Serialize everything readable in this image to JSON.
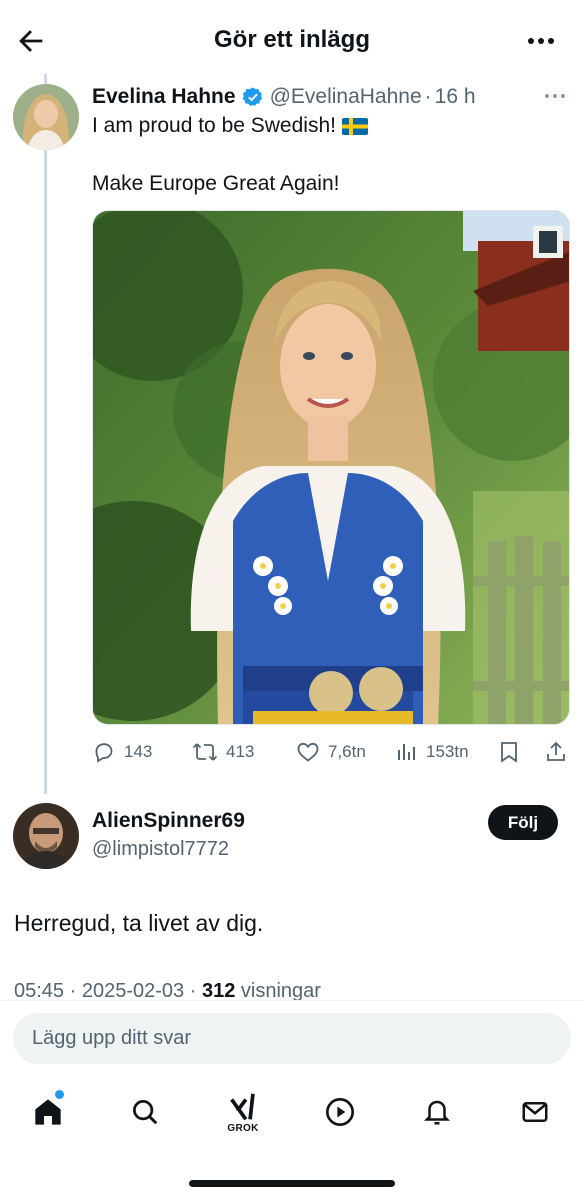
{
  "header": {
    "title": "Gör ett inlägg",
    "back_icon": "back-arrow-icon",
    "more_icon": "more-icon"
  },
  "tweet": {
    "author_name": "Evelina Hahne",
    "handle": "@EvelinaHahne",
    "separator": "·",
    "time": "16 h",
    "text_line1": "I am proud to be Swedish!",
    "text_line2": "Make Europe Great Again!",
    "flag_icon": "swedish-flag-icon",
    "verified_icon": "verified-badge-icon",
    "stats": {
      "replies": "143",
      "reposts": "413",
      "likes": "7,6tn",
      "views": "153tn"
    }
  },
  "reply": {
    "author_name": "AlienSpinner69",
    "handle": "@limpistol7772",
    "follow_label": "Följ",
    "text": "Herregud, ta livet av dig.",
    "time": "05:45",
    "separator": "·",
    "date": "2025-02-03",
    "views_count": "312",
    "views_label": "visningar"
  },
  "compose": {
    "placeholder": "Lägg upp ditt svar"
  },
  "nav": {
    "grok_label": "GROK"
  },
  "colors": {
    "accent": "#1d9bf0",
    "text": "#0f1419",
    "secondary": "#536471",
    "swedish_blue": "#006aa7",
    "swedish_yellow": "#fecc00"
  }
}
